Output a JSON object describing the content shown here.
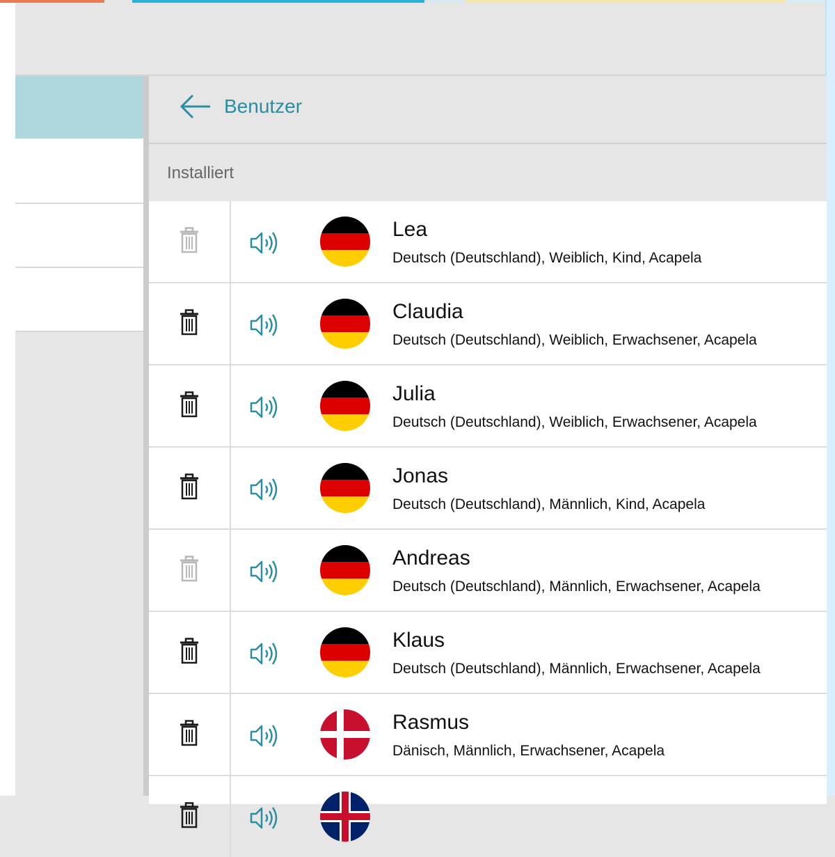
{
  "colors": {
    "accent": "#2a8ea1",
    "selection": "#b1d7de",
    "background": "#e6e6e6",
    "top_strip": [
      "#e97b52",
      "#25b3d8",
      "#d8e8f0",
      "#f4e9a6",
      "#d8ecf6"
    ]
  },
  "header": {
    "back_label": "Benutzer",
    "back_icon": "arrow-left-icon"
  },
  "section": {
    "label": "Installiert"
  },
  "voices": [
    {
      "name": "Lea",
      "description": "Deutsch (Deutschland), Weiblich, Kind, Acapela",
      "flag": "germany",
      "delete_enabled": false
    },
    {
      "name": "Claudia",
      "description": "Deutsch (Deutschland), Weiblich, Erwachsener, Acapela",
      "flag": "germany",
      "delete_enabled": true
    },
    {
      "name": "Julia",
      "description": "Deutsch (Deutschland), Weiblich, Erwachsener, Acapela",
      "flag": "germany",
      "delete_enabled": true
    },
    {
      "name": "Jonas",
      "description": "Deutsch (Deutschland), Männlich, Kind, Acapela",
      "flag": "germany",
      "delete_enabled": true
    },
    {
      "name": "Andreas",
      "description": "Deutsch (Deutschland), Männlich, Erwachsener, Acapela",
      "flag": "germany",
      "delete_enabled": false
    },
    {
      "name": "Klaus",
      "description": "Deutsch (Deutschland), Männlich, Erwachsener, Acapela",
      "flag": "germany",
      "delete_enabled": true
    },
    {
      "name": "Rasmus",
      "description": "Dänisch, Männlich, Erwachsener, Acapela",
      "flag": "denmark",
      "delete_enabled": true
    },
    {
      "name": "",
      "description": "",
      "flag": "united-kingdom",
      "delete_enabled": true
    }
  ]
}
